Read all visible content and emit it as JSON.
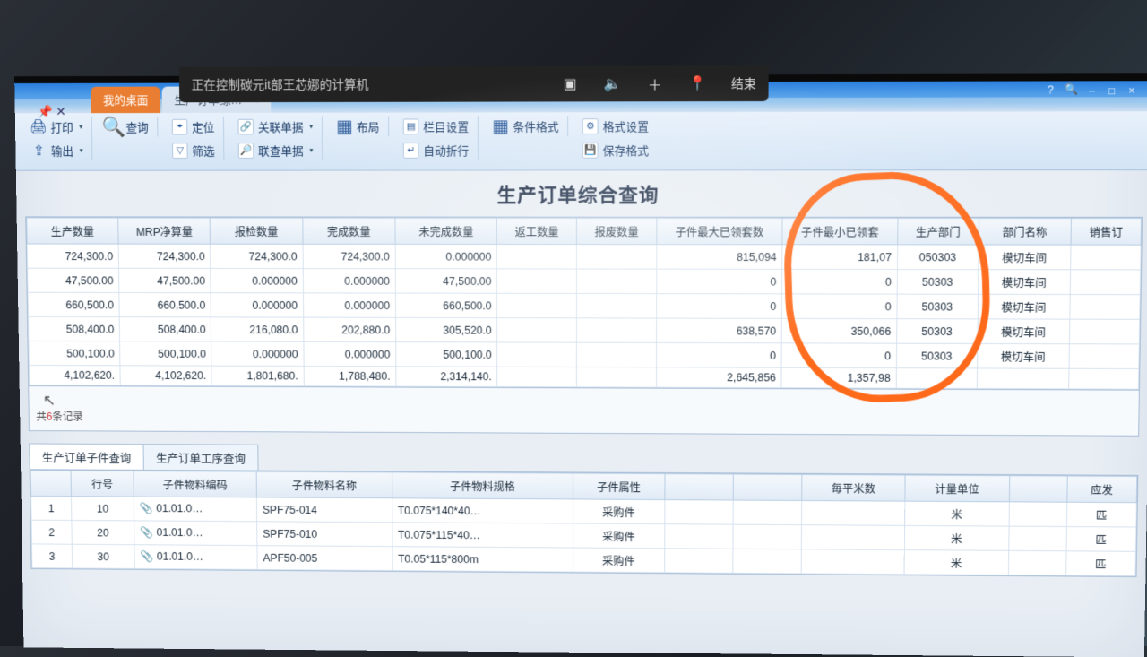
{
  "remote": {
    "status": "正在控制碳元it部王芯娜的计算机",
    "end": "结束"
  },
  "tabs": {
    "desktop": "我的桌面",
    "current": "生产订单综…"
  },
  "ribbon": {
    "print": "打印",
    "export": "输出",
    "query": "查询",
    "locate": "定位",
    "filter": "筛选",
    "relDoc": "关联单据",
    "unionDoc": "联查单据",
    "layout": "布局",
    "colSetting": "栏目设置",
    "autoWrap": "自动折行",
    "condFmt": "条件格式",
    "fmtSetting": "格式设置",
    "saveFmt": "保存格式"
  },
  "title": "生产订单综合查询",
  "columns": [
    "生产数量",
    "MRP净算量",
    "报检数量",
    "完成数量",
    "未完成数量",
    "返工数量",
    "报废数量",
    "子件最大已领套数",
    "子件最小已领套",
    "生产部门",
    "部门名称",
    "销售订"
  ],
  "rows": [
    {
      "c": [
        "724,300.0",
        "724,300.0",
        "724,300.0",
        "724,300.0",
        "0.000000",
        "",
        "",
        "815,094",
        "181,07",
        "050303",
        "模切车间",
        ""
      ]
    },
    {
      "c": [
        "47,500.00",
        "47,500.00",
        "0.000000",
        "0.000000",
        "47,500.00",
        "",
        "",
        "0",
        "0",
        "50303",
        "模切车间",
        ""
      ]
    },
    {
      "c": [
        "660,500.0",
        "660,500.0",
        "0.000000",
        "0.000000",
        "660,500.0",
        "",
        "",
        "0",
        "0",
        "50303",
        "模切车间",
        ""
      ]
    },
    {
      "c": [
        "508,400.0",
        "508,400.0",
        "216,080.0",
        "202,880.0",
        "305,520.0",
        "",
        "",
        "638,570",
        "350,066",
        "50303",
        "模切车间",
        ""
      ]
    },
    {
      "c": [
        "500,100.0",
        "500,100.0",
        "0.000000",
        "0.000000",
        "500,100.0",
        "",
        "",
        "0",
        "0",
        "50303",
        "模切车间",
        ""
      ]
    },
    {
      "c": [
        "4,102,620.",
        "4,102,620.",
        "1,801,680.",
        "1,788,480.",
        "2,314,140.",
        "",
        "",
        "2,645,856",
        "1,357,98",
        "",
        "",
        ""
      ]
    }
  ],
  "recordCount": {
    "prefix": "共",
    "num": "6",
    "suffix": "条记录"
  },
  "sub": {
    "tab1": "生产订单子件查询",
    "tab2": "生产订单工序查询",
    "columns": [
      "",
      "行号",
      "子件物料编码",
      "子件物料名称",
      "子件物料规格",
      "子件属性",
      "",
      "",
      "毎平米数",
      "计量单位",
      "",
      "应发"
    ],
    "rows": [
      {
        "n": "1",
        "line": "10",
        "code": "01.01.0…",
        "name": "SPF75-014",
        "spec": "T0.075*140*40…",
        "attr": "采购件",
        "unit1": "米",
        "unit2": "匹"
      },
      {
        "n": "2",
        "line": "20",
        "code": "01.01.0…",
        "name": "SPF75-010",
        "spec": "T0.075*115*40…",
        "attr": "采购件",
        "unit1": "米",
        "unit2": "匹"
      },
      {
        "n": "3",
        "line": "30",
        "code": "01.01.0…",
        "name": "APF50-005",
        "spec": "T0.05*115*800m",
        "attr": "采购件",
        "unit1": "米",
        "unit2": "匹"
      }
    ]
  }
}
